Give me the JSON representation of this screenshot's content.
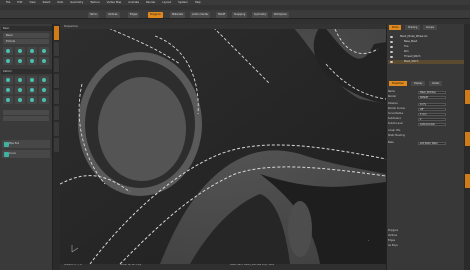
{
  "menu": [
    "File",
    "Edit",
    "View",
    "Select",
    "Item",
    "Geometry",
    "Texture",
    "Vertex Map",
    "Animate",
    "Render",
    "Layout",
    "System",
    "Help"
  ],
  "title": "",
  "toolbar": {
    "buttons": [
      "Items",
      "Vertices",
      "Edges",
      "Polygons",
      "Materials",
      "Action Center",
      "Falloff",
      "Snapping",
      "Symmetry",
      "Workplane"
    ]
  },
  "left_panel": {
    "section_basic": "Basic",
    "section_deform": "Deform",
    "tools": [
      "Bevel",
      "Extrude",
      "Loop Slice",
      "Edge Slice",
      "Smooth",
      "Push",
      "Bridge",
      "Thicken",
      "Spin Quad",
      "Slice"
    ],
    "tool_pipe": "Pipe Tool",
    "tool_curve": "Curve"
  },
  "viewport": {
    "label": "Perspective",
    "axis_label": "Y"
  },
  "right_panel": {
    "tabs": [
      "Items",
      "Shading",
      "Groups"
    ],
    "tree": [
      "Mesh_Model_Wheel.lxo",
      "Base_Mesh",
      "Tire",
      "Rim",
      "Thread_Stitch",
      "Mesh_Stitch"
    ],
    "props_tabs": [
      "Properties",
      "Display",
      "Vertex"
    ],
    "props": [
      {
        "label": "Name",
        "value": "Mesh_Stitches"
      },
      {
        "label": "Render",
        "value": "Default"
      },
      {
        "label": "Dissolve",
        "value": "0.0 %"
      },
      {
        "label": "Render Curves",
        "value": "Off"
      },
      {
        "label": "Curve Radius",
        "value": "5 mm"
      },
      {
        "label": "Subdivision",
        "value": "2"
      },
      {
        "label": "Subdiv Level",
        "value": "Catmull-Clark"
      },
      {
        "label": "Linear UVs",
        "value": ""
      },
      {
        "label": "Static Meshing",
        "value": ""
      },
      {
        "label": "Bake",
        "value": "Add Static Mesh"
      }
    ],
    "info_lines": [
      "Polygons",
      "Vertices",
      "Edges",
      "GL Polys"
    ]
  },
  "status": {
    "left": "Position X, Y, Z",
    "mid": "Show: All  GL: Poly",
    "right": "Mesh Item: Mesh_Stitches  Poly: 1024"
  }
}
